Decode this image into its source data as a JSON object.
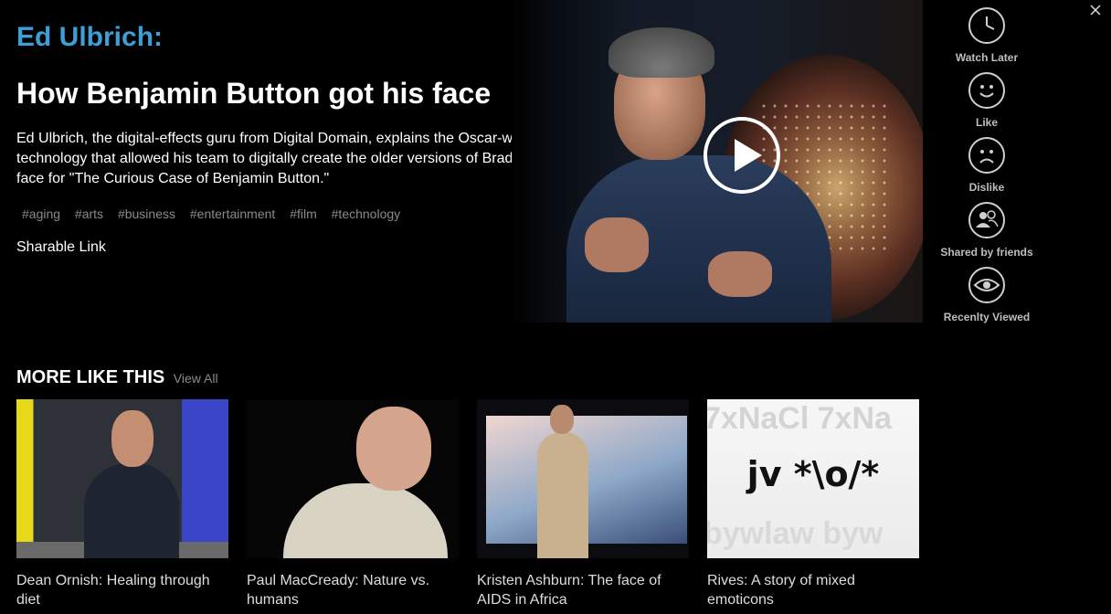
{
  "talk": {
    "speaker": "Ed Ulbrich:",
    "title": "How Benjamin Button got his face",
    "description": "Ed Ulbrich, the digital-effects guru from Digital Domain, explains the Oscar-winning technology that allowed his team to digitally create the older versions of Brad Pitt's face for \"The Curious Case of Benjamin Button.\"",
    "tags": [
      "#aging",
      "#arts",
      "#business",
      "#entertainment",
      "#film",
      "#technology"
    ],
    "share_label": "Sharable Link"
  },
  "video": {
    "play_icon": "play-icon"
  },
  "sidebar": {
    "actions": [
      {
        "label": "Watch Later",
        "icon": "clock-icon"
      },
      {
        "label": "Like",
        "icon": "smile-icon"
      },
      {
        "label": "Dislike",
        "icon": "frown-icon"
      },
      {
        "label": "Shared by friends",
        "icon": "friends-icon"
      },
      {
        "label": "Recenlty Viewed",
        "icon": "eye-icon"
      }
    ]
  },
  "more": {
    "heading": "MORE LIKE THIS",
    "view_all": "View All",
    "items": [
      {
        "title": "Dean Ornish: Healing through diet"
      },
      {
        "title": "Paul MacCready: Nature vs. humans"
      },
      {
        "title": "Kristen Ashburn: The face of AIDS in Africa"
      },
      {
        "title": "Rives: A story of mixed emoticons",
        "thumb_text": "jv *\\o/*",
        "thumb_bg_top": "7xNaCl 7xNa",
        "thumb_bg_bottom": "bywlaw byw"
      }
    ]
  },
  "colors": {
    "speaker": "#3d9fd6",
    "background": "#000000",
    "tag": "#8a8a8a"
  }
}
